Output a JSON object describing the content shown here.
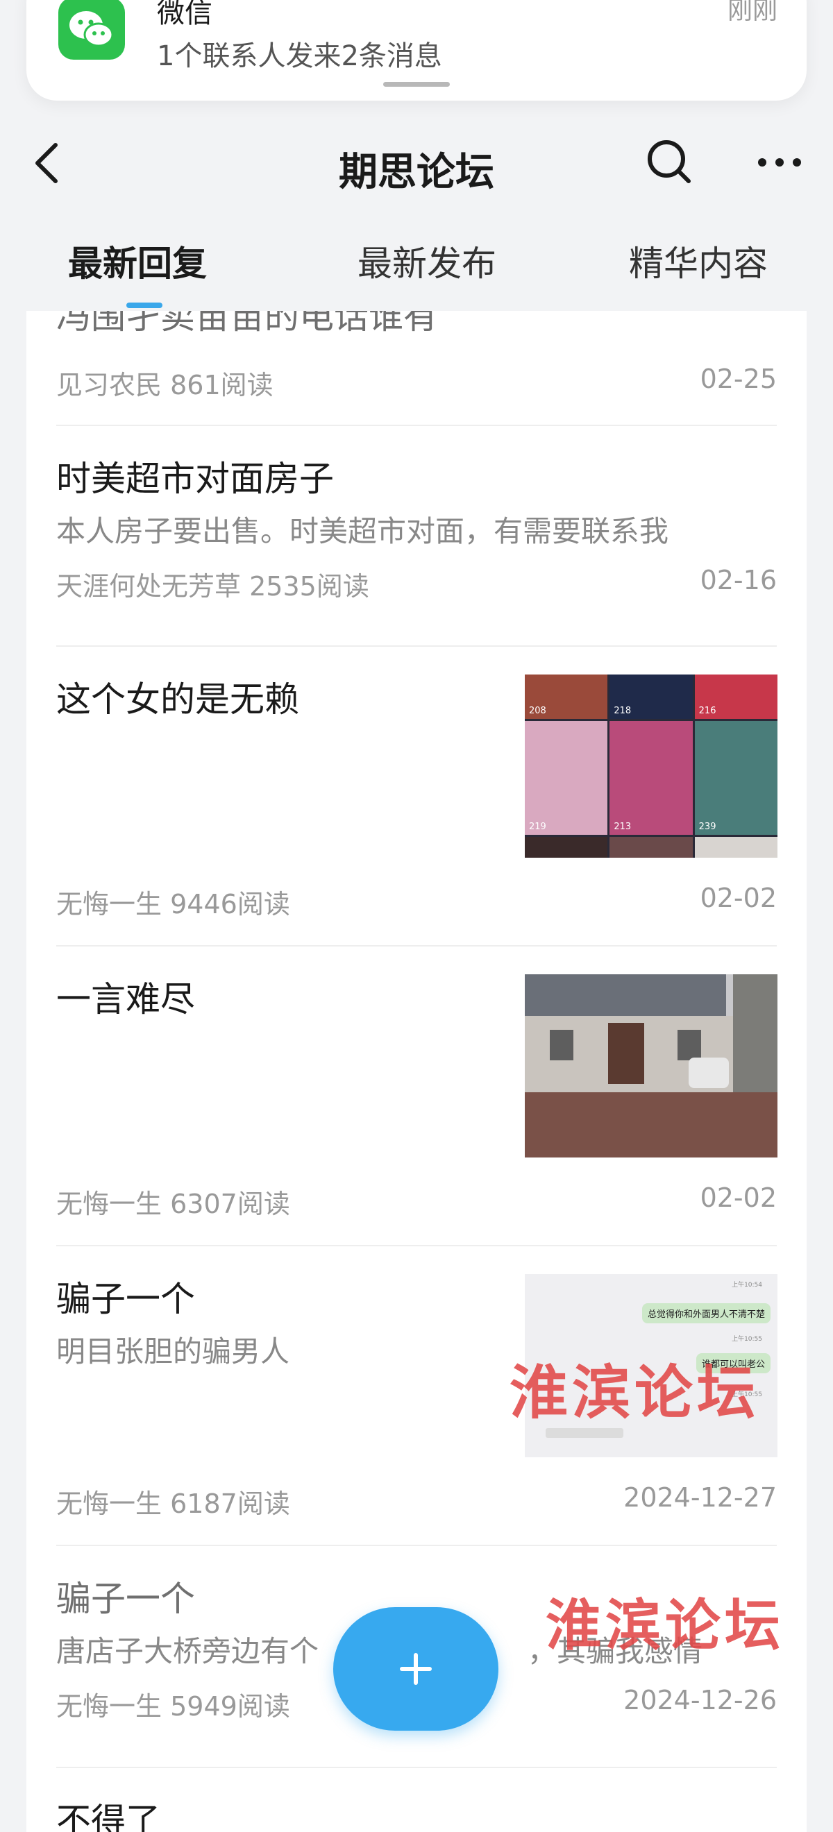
{
  "notification": {
    "app": "微信",
    "time": "刚刚",
    "message": "1个联系人发来2条消息"
  },
  "nav": {
    "title": "期思论坛"
  },
  "tabs": [
    {
      "label": "最新回复",
      "active": true
    },
    {
      "label": "最新发布",
      "active": false
    },
    {
      "label": "精华内容",
      "active": false
    }
  ],
  "posts": [
    {
      "title": "冯围孑卖苗苗的电话谁有",
      "body": "",
      "author": "见习农民",
      "reads": "861阅读",
      "date": "02-25"
    },
    {
      "title": "时美超市对面房子",
      "body": "本人房子要出售。时美超市对面，有需要联系我",
      "author": "天涯何处无芳草",
      "reads": "2535阅读",
      "date": "02-16"
    },
    {
      "title": "这个女的是无赖",
      "body": "",
      "author": "无悔一生",
      "reads": "9446阅读",
      "date": "02-02"
    },
    {
      "title": "一言难尽",
      "body": "",
      "author": "无悔一生",
      "reads": "6307阅读",
      "date": "02-02"
    },
    {
      "title": "骗子一个",
      "body": "明目张胆的骗男人",
      "author": "无悔一生",
      "reads": "6187阅读",
      "date": "2024-12-27"
    },
    {
      "title": "骗子一个",
      "body": "唐店子大桥旁边有个",
      "body_tail": "，其骗我感情",
      "author": "无悔一生",
      "reads": "5949阅读",
      "date": "2024-12-26"
    },
    {
      "title": "不得了",
      "body": "",
      "author": "",
      "reads": "",
      "date": ""
    }
  ],
  "thumb_grid": {
    "likes": [
      "208",
      "218",
      "216",
      "219",
      "213",
      "239"
    ]
  },
  "thumb_chat": {
    "times": [
      "上午10:54",
      "上午10:55",
      "上午10:55"
    ],
    "bubbles": [
      "总觉得你和外面男人不清不楚",
      "谁都可以叫老公"
    ]
  },
  "watermark": "淮滨论坛",
  "colors": {
    "accent": "#3aa7ea",
    "fab": "#37a9ef",
    "wechat": "#2dc14e",
    "watermark": "#e24848"
  }
}
